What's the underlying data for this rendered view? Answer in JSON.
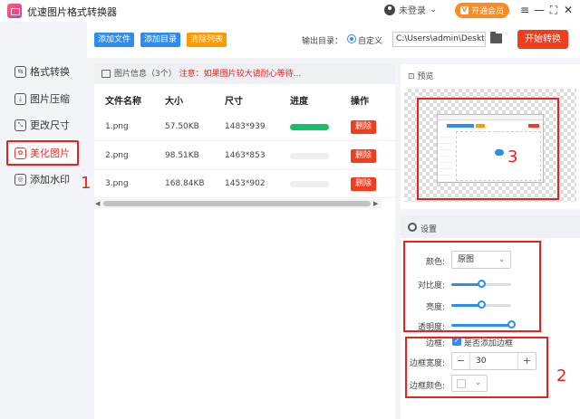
{
  "app": {
    "title": "优速图片格式转换器",
    "user_label": "未登录",
    "user_caret": "⌄",
    "vip_label": "开通会员",
    "vip_icon_text": "V",
    "win_controls": {
      "menu": "≡",
      "minimize": "—",
      "maximize": "⛶",
      "close": "✕"
    }
  },
  "toolbar": {
    "add_file": "添加文件",
    "add_dir": "添加目录",
    "clear_list": "清除列表",
    "output_label": "输出目录：",
    "custom_label": "自定义",
    "output_path": "C:\\Users\\admin\\Deskto",
    "start": "开始转换"
  },
  "sidebar": {
    "items": [
      {
        "label": "格式转换",
        "icon": "⇆"
      },
      {
        "label": "图片压缩",
        "icon": "⤓"
      },
      {
        "label": "更改尺寸",
        "icon": "⤡"
      },
      {
        "label": "美化图片",
        "icon": "✿"
      },
      {
        "label": "添加水印",
        "icon": "◎"
      }
    ],
    "active_index": 3
  },
  "list": {
    "header": "图片信息（3个）",
    "notice": "注意：如果图片较大请耐心等待...",
    "columns": [
      "文件名称",
      "大小",
      "尺寸",
      "进度",
      "操作"
    ],
    "rows": [
      {
        "name": "1.png",
        "size": "57.50KB",
        "dims": "1483*939",
        "progress": 1.0,
        "action": "删除"
      },
      {
        "name": "2.png",
        "size": "98.51KB",
        "dims": "1463*853",
        "progress": 0,
        "action": "删除"
      },
      {
        "name": "3.png",
        "size": "168.84KB",
        "dims": "1453*902",
        "progress": 0,
        "action": "删除"
      }
    ],
    "scroll_left": "◀",
    "scroll_right": "▶"
  },
  "preview": {
    "title": "预览"
  },
  "settings": {
    "title": "设置",
    "color_label": "颜色:",
    "color_value": "原图",
    "contrast_label": "对比度:",
    "contrast_value": 0.5,
    "brightness_label": "亮度:",
    "brightness_value": 0.5,
    "opacity_label": "透明度:",
    "opacity_value": 1.0,
    "border_label": "边框:",
    "border_check_label": "是否添加边框",
    "border_checked": true,
    "border_width_label": "边框宽度:",
    "border_width": "30",
    "border_color_label": "边框颜色:",
    "stepper_minus": "−",
    "stepper_plus": "+",
    "chevron": "⌄",
    "check_mark": "✓"
  },
  "annotations": {
    "one": "1",
    "two": "2",
    "three": "3"
  },
  "colors": {
    "accent": "#2d8cf0",
    "danger": "#f23c1e",
    "warning": "#ff9900",
    "success": "#19be6b",
    "highlight": "#e52222"
  }
}
